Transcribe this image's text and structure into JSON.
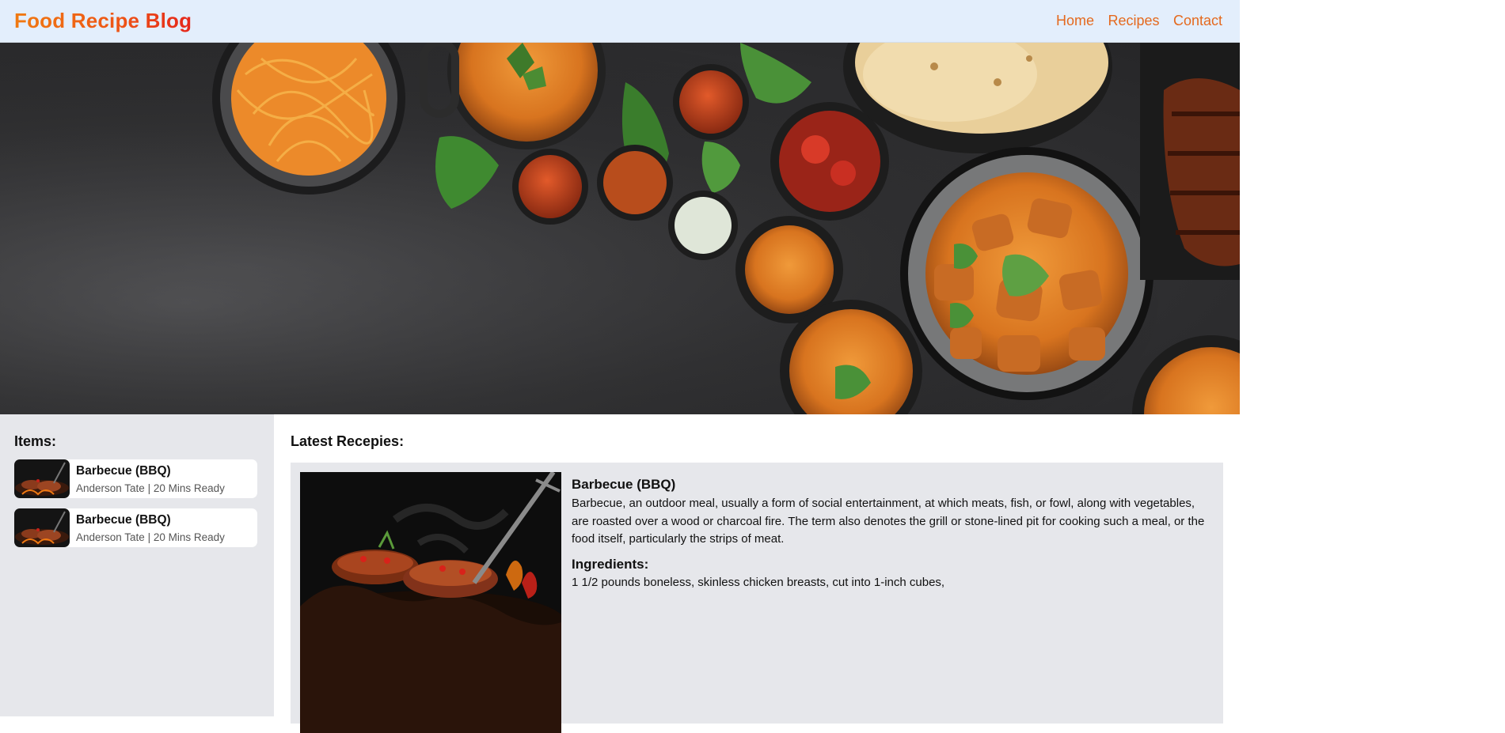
{
  "header": {
    "brand": "Food Recipe Blog",
    "nav": [
      "Home",
      "Recipes",
      "Contact"
    ]
  },
  "hero": {
    "image": "indian-food-spread"
  },
  "sidebar": {
    "title": "Items:",
    "items": [
      {
        "title": "Barbecue (BBQ)",
        "meta": "Anderson Tate | 20 Mins Ready",
        "thumb": "bbq-thumb"
      },
      {
        "title": "Barbecue (BBQ)",
        "meta": "Anderson Tate | 20 Mins Ready",
        "thumb": "bbq-thumb"
      }
    ]
  },
  "main": {
    "title": "Latest Recepies:",
    "card": {
      "title": "Barbecue (BBQ)",
      "description": "Barbecue, an outdoor meal, usually a form of social entertainment, at which meats, fish, or fowl, along with vegetables, are roasted over a wood or charcoal fire. The term also denotes the grill or stone-lined pit for cooking such a meal, or the food itself, particularly the strips of meat.",
      "ingredients_title": "Ingredients:",
      "ingredients_first": "1 1/2 pounds boneless, skinless chicken breasts, cut into 1-inch cubes,"
    }
  },
  "colors": {
    "header_bg": "#e3eefc",
    "brand_orange": "#f07a12",
    "brand_red": "#e5261b",
    "nav_link": "#e4691e",
    "panel_bg": "#e6e7eb"
  }
}
